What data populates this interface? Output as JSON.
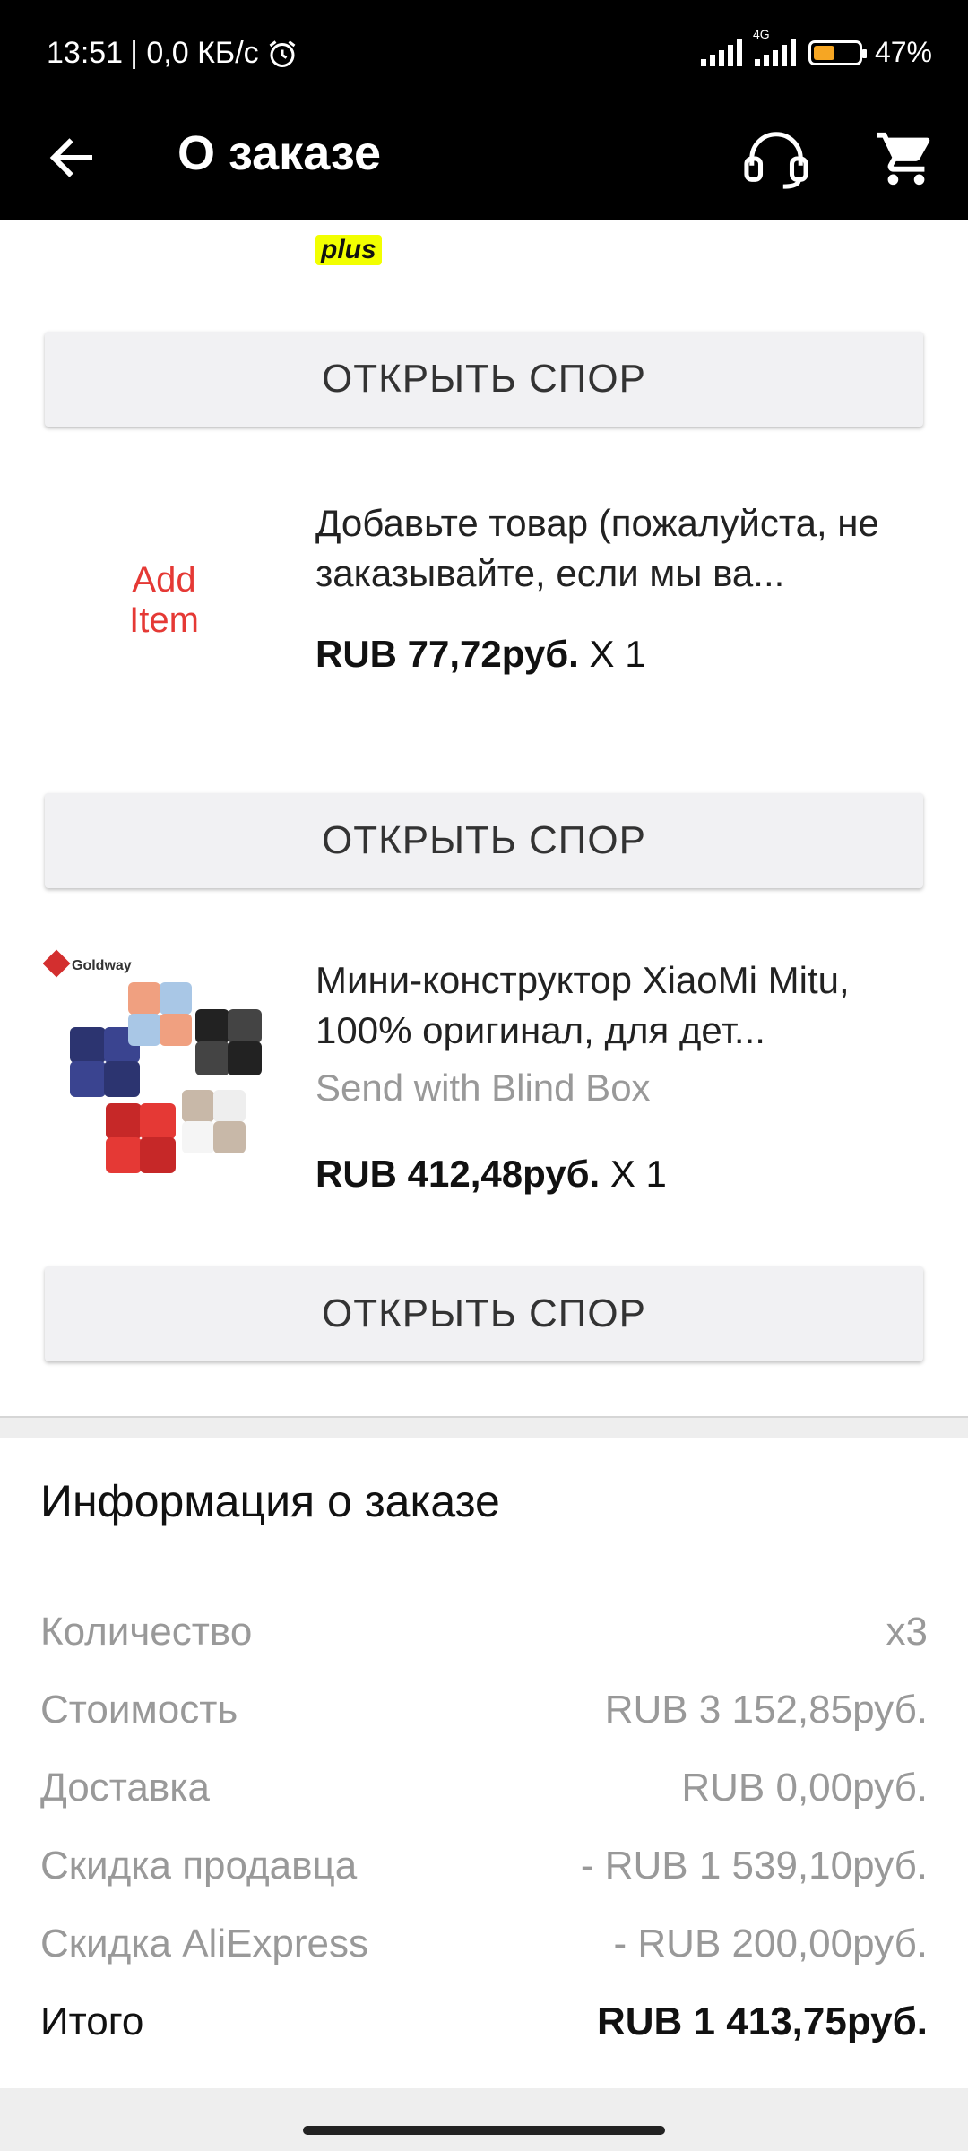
{
  "status_bar": {
    "time": "13:51",
    "speed": "| 0,0 КБ/с",
    "network": "4G",
    "battery": "47%",
    "battery_level": 0.47,
    "battery_color": "#f6a623"
  },
  "app_bar": {
    "title": "О заказе",
    "icons": [
      "back-arrow-icon",
      "headset-icon",
      "cart-icon"
    ]
  },
  "partial_item": {
    "badge": "plus"
  },
  "dispute_label": "ОТКРЫТЬ СПОР",
  "products": [
    {
      "image_text": "Add Item",
      "name": "Добавьте товар (пожалуйста, не заказывайте, если мы ва...",
      "price": "RUB 77,72руб.",
      "qty": "X 1"
    },
    {
      "image_brand": "Goldway",
      "name": "Мини-конструктор XiaoMi Mitu, 100% оригинал, для дет...",
      "variant": "Send with Blind Box",
      "price": "RUB 412,48руб.",
      "qty": "X 1"
    }
  ],
  "order_info": {
    "title": "Информация о заказе",
    "rows": [
      {
        "label": "Количество",
        "value": "x3"
      },
      {
        "label": "Стоимость",
        "value": "RUB 3 152,85руб."
      },
      {
        "label": "Доставка",
        "value": "RUB 0,00руб."
      },
      {
        "label": "Скидка продавца",
        "value": "- RUB 1 539,10руб."
      },
      {
        "label": "Скидка AliExpress",
        "value": "- RUB 200,00руб."
      }
    ],
    "total": {
      "label": "Итого",
      "value": "RUB 1 413,75руб."
    }
  }
}
